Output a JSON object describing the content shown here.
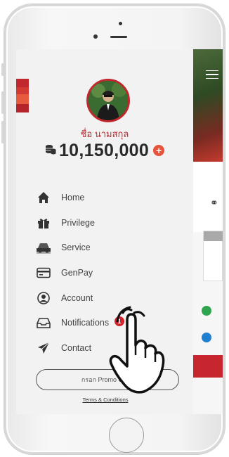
{
  "user": {
    "name": "ชื่อ นามสกุล",
    "points": "10,150,000",
    "add_points_label": "+"
  },
  "menu": [
    {
      "label": "Home",
      "icon": "home-icon"
    },
    {
      "label": "Privilege",
      "icon": "gift-icon"
    },
    {
      "label": "Service",
      "icon": "service-icon"
    },
    {
      "label": "GenPay",
      "icon": "card-icon"
    },
    {
      "label": "Account",
      "icon": "user-circle-icon"
    },
    {
      "label": "Notifications",
      "icon": "inbox-icon",
      "badge": "1"
    },
    {
      "label": "Contact",
      "icon": "paper-plane-icon"
    }
  ],
  "promo": {
    "label": "กรอก Promo Code"
  },
  "terms": {
    "label": "Terms & Conditions"
  },
  "colors": {
    "accent": "#c0282d",
    "accent_light": "#e6543a",
    "badge": "#d4232d",
    "drawer_bg": "#f2f2f2"
  }
}
